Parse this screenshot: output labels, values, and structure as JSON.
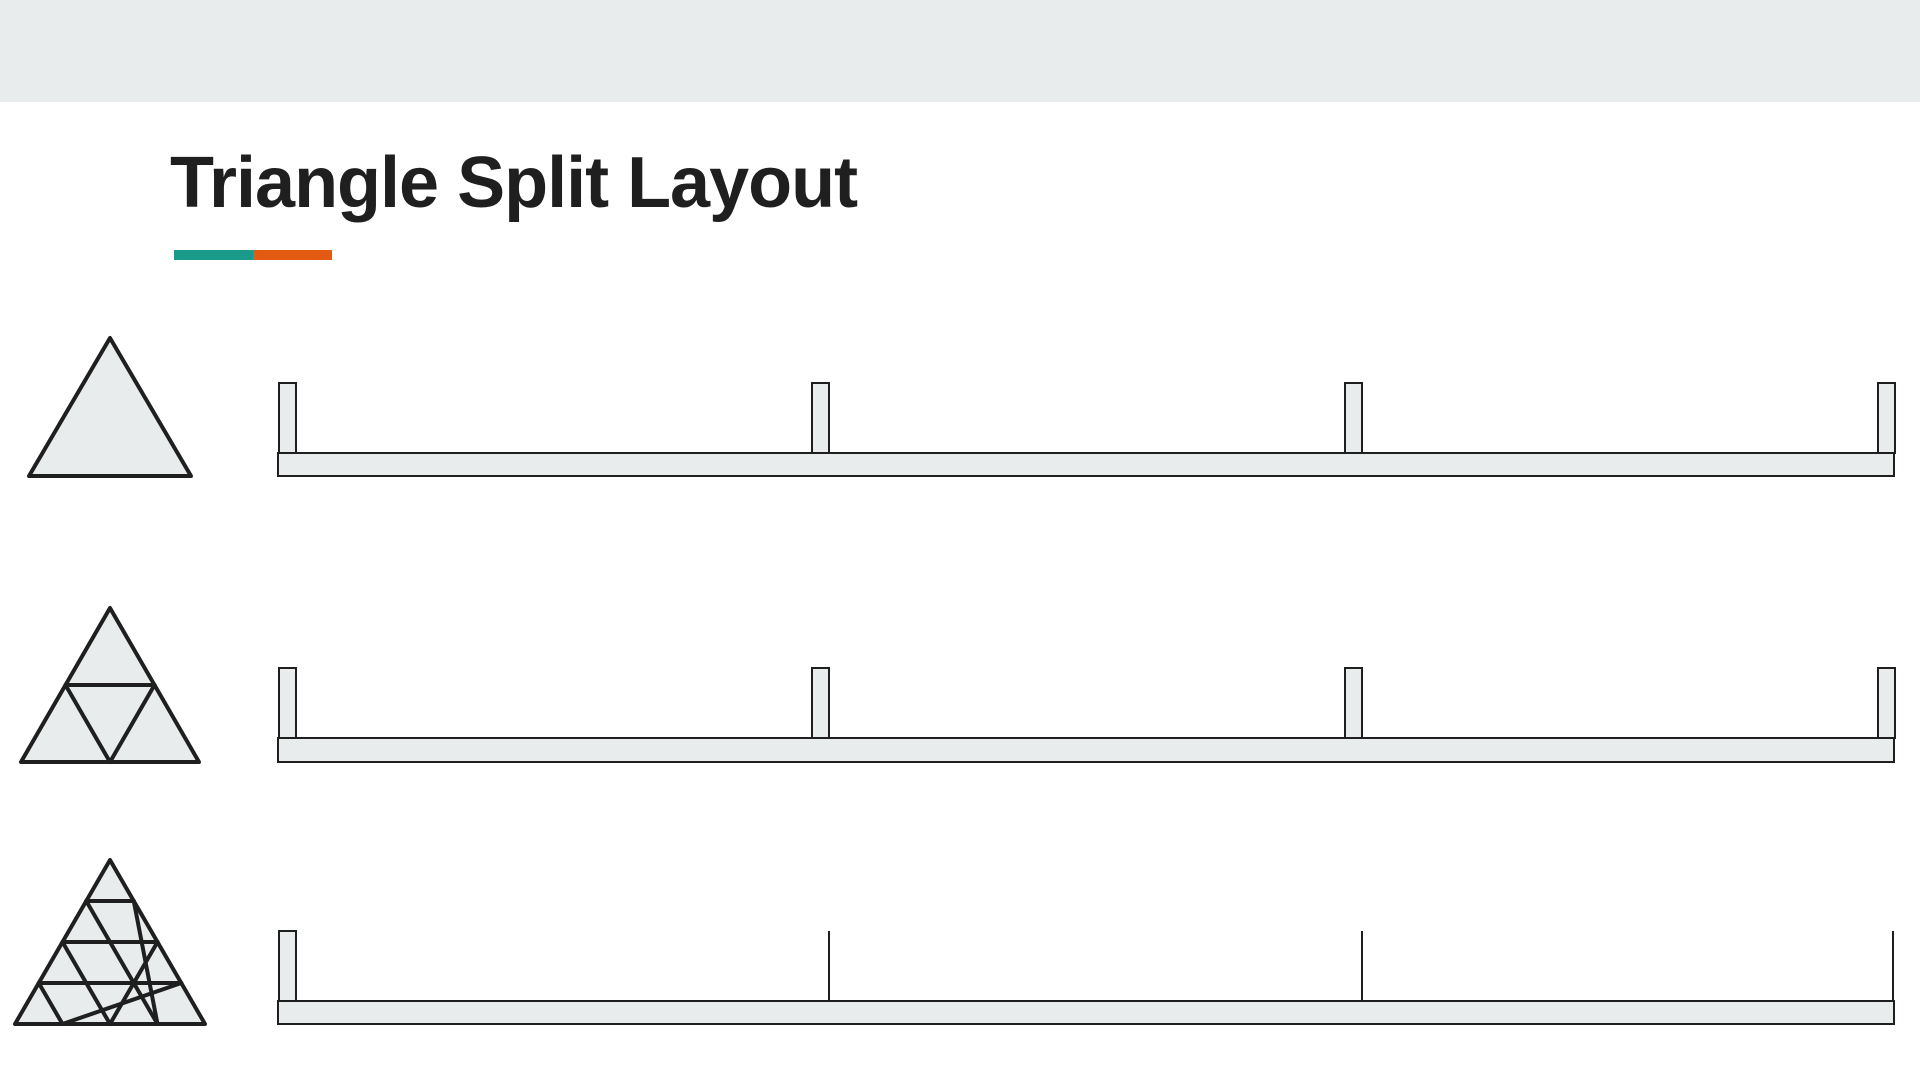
{
  "header": {
    "title": "Triangle Split Layout"
  },
  "colors": {
    "accent_left": "#1a9a8a",
    "accent_right": "#e35a12",
    "panel_fill": "#e8eced",
    "stroke": "#1f1f1f",
    "band": "#e8eced"
  },
  "rows": [
    {
      "subdivisions": 1,
      "post_style": [
        "post",
        "post",
        "post",
        "post"
      ]
    },
    {
      "subdivisions": 2,
      "post_style": [
        "post",
        "post",
        "post",
        "post"
      ]
    },
    {
      "subdivisions": 4,
      "post_style": [
        "post",
        "line",
        "line",
        "line"
      ]
    }
  ]
}
